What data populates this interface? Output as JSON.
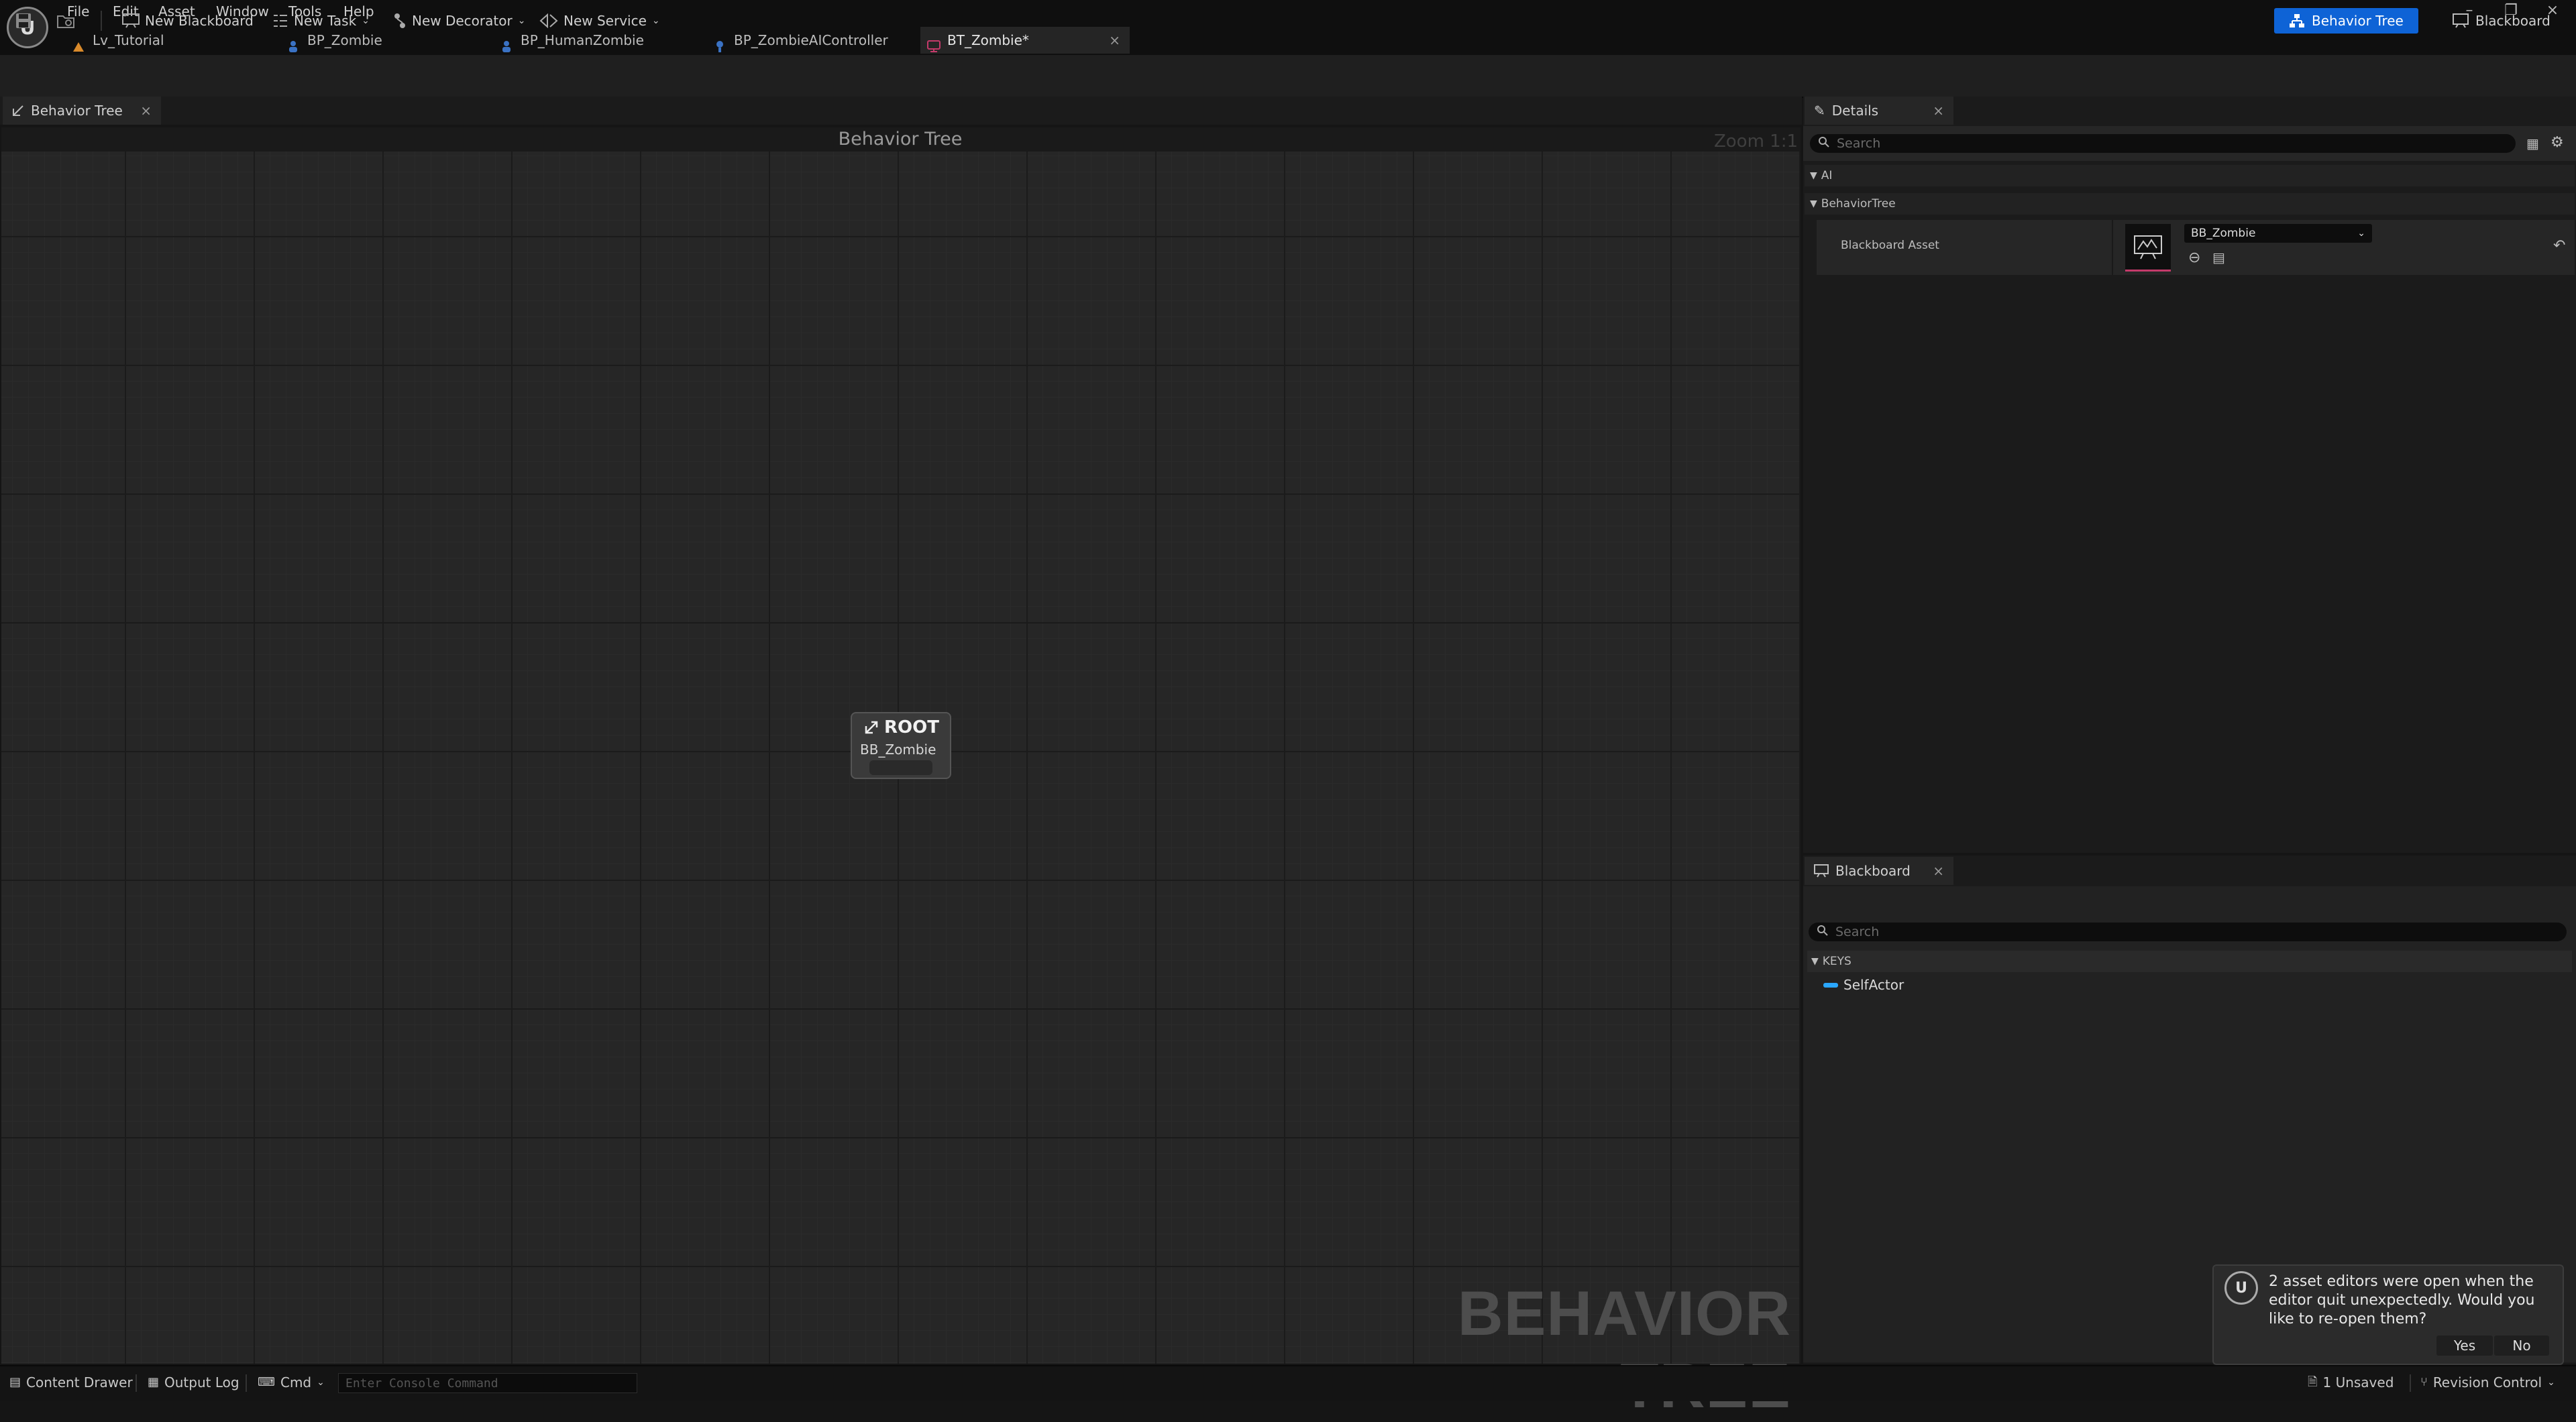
{
  "menu": {
    "items": [
      {
        "label": "File"
      },
      {
        "label": "Edit"
      },
      {
        "label": "Asset"
      },
      {
        "label": "Window"
      },
      {
        "label": "Tools"
      },
      {
        "label": "Help"
      }
    ]
  },
  "document_tabs": [
    {
      "label": "Lv_Tutorial",
      "icon": "level-icon",
      "color": "#d98a2b"
    },
    {
      "label": "BP_Zombie",
      "icon": "blueprint-pawn-icon",
      "color": "#3a72c4"
    },
    {
      "label": "BP_HumanZombie",
      "icon": "blueprint-pawn-icon",
      "color": "#3a72c4"
    },
    {
      "label": "BP_ZombieAIController",
      "icon": "ai-controller-icon",
      "color": "#3a72c4"
    },
    {
      "label": "BT_Zombie*",
      "icon": "behavior-tree-icon",
      "color": "#c43a6a",
      "active": true
    }
  ],
  "toolbar": {
    "new_blackboard": "New Blackboard",
    "new_task": "New Task",
    "new_decorator": "New Decorator",
    "new_service": "New Service",
    "mode_behavior_tree": "Behavior Tree",
    "mode_blackboard": "Blackboard",
    "accent_color": "#0e63d6"
  },
  "graph_panel": {
    "tab_label": "Behavior Tree",
    "header_title": "Behavior Tree",
    "zoom": "Zoom 1:1",
    "watermark": "BEHAVIOR TREE",
    "root_node": {
      "title": "ROOT",
      "subtitle": "BB_Zombie"
    }
  },
  "details_panel": {
    "tab_label": "Details",
    "search_placeholder": "Search",
    "categories": {
      "ai": "AI",
      "behavior_tree": "BehaviorTree"
    },
    "property_label": "Blackboard Asset",
    "property_value": "BB_Zombie"
  },
  "blackboard_panel": {
    "tab_label": "Blackboard",
    "search_placeholder": "Search",
    "keys_header": "KEYS",
    "keys": [
      {
        "name": "SelfActor",
        "color": "#2aa7ff"
      }
    ]
  },
  "statusbar": {
    "content_drawer": "Content Drawer",
    "output_log": "Output Log",
    "cmd": "Cmd",
    "console_placeholder": "Enter Console Command",
    "unsaved": "1 Unsaved",
    "revision_control": "Revision Control"
  },
  "toast": {
    "message": "2 asset editors were open when the editor quit unexpectedly. Would you like to re-open them?",
    "yes": "Yes",
    "no": "No"
  }
}
